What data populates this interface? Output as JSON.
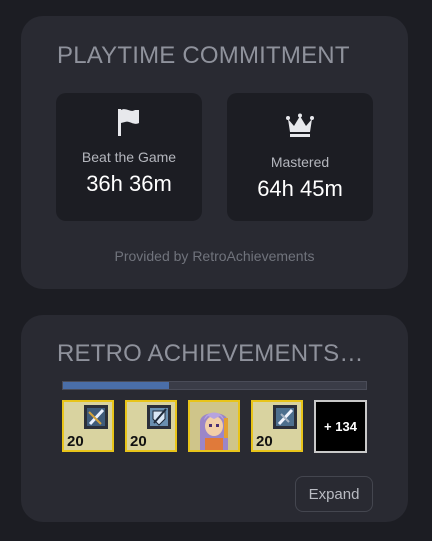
{
  "playtime": {
    "title": "PLAYTIME COMMITMENT",
    "beat": {
      "icon": "flag-icon",
      "label": "Beat the Game",
      "value": "36h 36m"
    },
    "mastered": {
      "icon": "crown-icon",
      "label": "Mastered",
      "value": "64h 45m"
    },
    "provided_by": "Provided by RetroAchievements"
  },
  "retro": {
    "title": "RETRO ACHIEVEMENTS (...",
    "progress_fraction": 0.35,
    "badges": [
      {
        "icon": "sword-badge-icon",
        "points": "20"
      },
      {
        "icon": "shield-badge-icon",
        "points": "20"
      },
      {
        "icon": "character-portrait-icon",
        "points": ""
      },
      {
        "icon": "sword-badge-icon",
        "points": "20"
      }
    ],
    "more_count": "+ 134",
    "expand_label": "Expand"
  },
  "colors": {
    "background": "#1c1d23",
    "card": "#292a32",
    "progress_fill": "#4a6ea8",
    "badge_border": "#e8c41a"
  }
}
